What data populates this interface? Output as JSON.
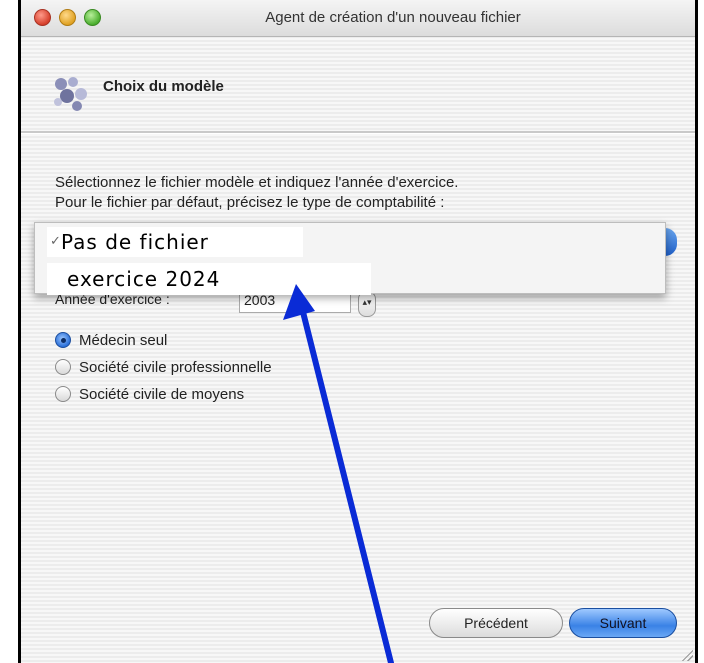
{
  "window": {
    "title": "Agent de création d'un nouveau fichier"
  },
  "header": {
    "title": "Choix du modèle",
    "icon": "wizard-icon"
  },
  "instructions": {
    "line1": "Sélectionnez le fichier modèle et indiquez l'année d'exercice.",
    "line2": "Pour le fichier par défaut, précisez le type de comptabilité :"
  },
  "model_menu": {
    "check_mark": "✓",
    "items": [
      "Pas de fichier",
      "exercice 2024"
    ]
  },
  "year": {
    "label": "Année d'exercice :",
    "value": "2003"
  },
  "accounting_type": {
    "options": [
      "Médecin seul",
      "Société civile professionnelle",
      "Société civile de moyens"
    ],
    "selected": "Médecin seul"
  },
  "buttons": {
    "previous": "Précédent",
    "next": "Suivant"
  },
  "annotation": {
    "arrow_color": "#0a2bd6"
  }
}
